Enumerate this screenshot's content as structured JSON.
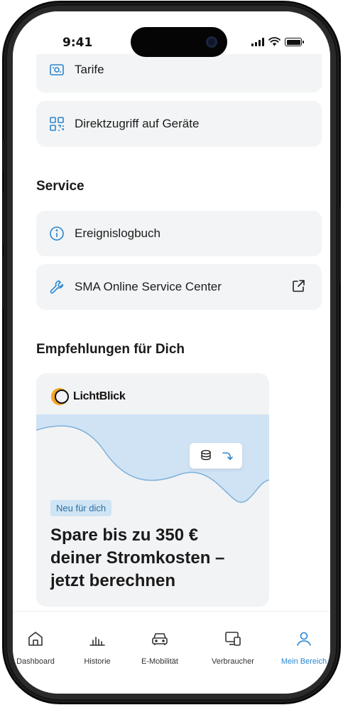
{
  "status_bar": {
    "time": "9:41"
  },
  "menu_top": [
    {
      "label": "Tarife",
      "icon": "tariff-icon"
    },
    {
      "label": "Direktzugriff auf Geräte",
      "icon": "qr-code-icon"
    }
  ],
  "service": {
    "title": "Service",
    "items": [
      {
        "label": "Ereignislogbuch",
        "icon": "info-icon"
      },
      {
        "label": "SMA Online Service Center",
        "icon": "wrench-icon",
        "trailing_icon": "external-link-icon"
      }
    ]
  },
  "recommendations": {
    "title": "Empfehlungen für Dich",
    "card": {
      "brand": "LichtBlick",
      "badge": "Neu für dich",
      "headline": "Spare bis zu 350 € deiner Stromkosten – jetzt berechnen"
    }
  },
  "tabbar": {
    "tabs": [
      {
        "label": "Dashboard",
        "icon": "home-icon",
        "active": false
      },
      {
        "label": "Historie",
        "icon": "bar-chart-icon",
        "active": false
      },
      {
        "label": "E-Mobilität",
        "icon": "car-icon",
        "active": false
      },
      {
        "label": "Verbraucher",
        "icon": "devices-icon",
        "active": false
      },
      {
        "label": "Mein Bereich",
        "icon": "user-icon",
        "active": true
      }
    ]
  },
  "colors": {
    "accent": "#2a86cf",
    "row_background": "#f3f4f5",
    "badge_background": "#cfe4f4",
    "wave_fill": "#cfe3f5",
    "brand_orange": "#f5a623"
  }
}
